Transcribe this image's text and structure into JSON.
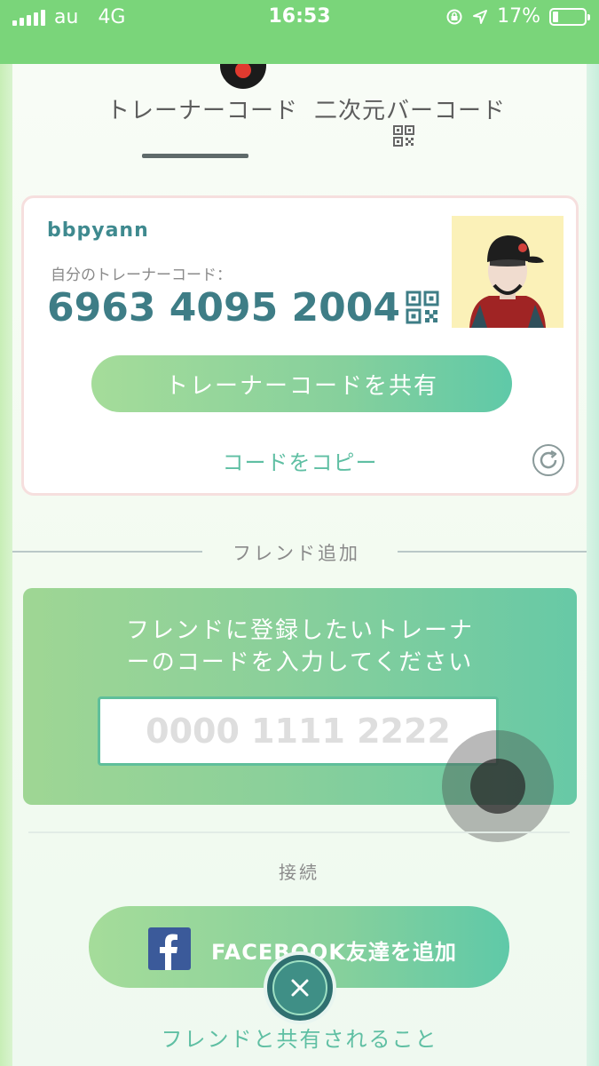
{
  "status_bar": {
    "carrier": "au",
    "network": "4G",
    "time": "16:53",
    "battery_percent": "17%",
    "battery_level": 0.17
  },
  "tabs": {
    "trainer_code": "トレーナーコード",
    "qr_code": "二次元バーコード"
  },
  "profile": {
    "username": "bbpyann",
    "code_label": "自分のトレーナーコード：",
    "code": "6963 4095 2004",
    "share_label": "トレーナーコードを共有",
    "copy_label": "コードをコピー"
  },
  "add_friend": {
    "section_title": "フレンド追加",
    "instruction_line1": "フレンドに登録したいトレーナ",
    "instruction_line2": "ーのコードを入力してください",
    "input_placeholder": "0000 1111 2222"
  },
  "connect": {
    "section_title": "接続",
    "facebook_label": "FACEBOOK友達を追加",
    "shared_link": "フレンドと共有されること"
  },
  "colors": {
    "status_bar": "#7ad57a",
    "accent_teal": "#5fbfa3",
    "code_blue": "#3e7d86",
    "facebook": "#3b5a9a"
  },
  "icons": [
    "signal-icon",
    "screen-lock-icon",
    "location-icon",
    "battery-icon",
    "qr-code-icon",
    "refresh-icon",
    "facebook-icon",
    "close-icon"
  ]
}
